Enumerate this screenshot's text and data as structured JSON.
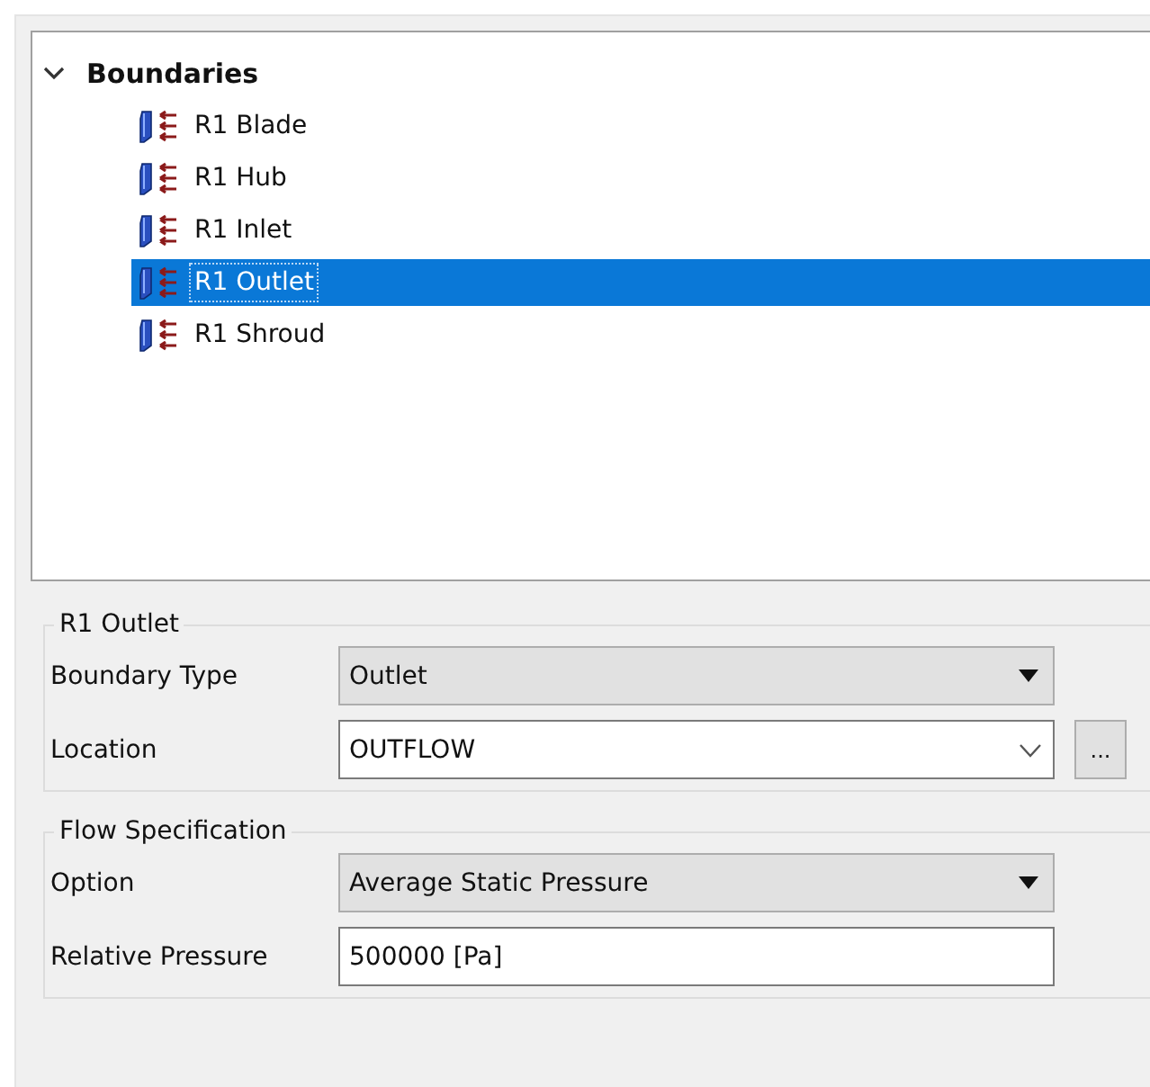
{
  "tree": {
    "root": {
      "label": "Boundaries",
      "expanded": true,
      "children": [
        {
          "label": "R1 Blade",
          "selected": false
        },
        {
          "label": "R1 Hub",
          "selected": false
        },
        {
          "label": "R1 Inlet",
          "selected": false
        },
        {
          "label": "R1 Outlet",
          "selected": true
        },
        {
          "label": "R1 Shroud",
          "selected": false
        }
      ]
    }
  },
  "groups": [
    {
      "title": "R1 Outlet",
      "fields": [
        {
          "kind": "dropdown",
          "label": "Boundary Type",
          "value": "Outlet"
        },
        {
          "kind": "combo",
          "label": "Location",
          "value": "OUTFLOW",
          "button": "..."
        }
      ]
    },
    {
      "title": "Flow Specification",
      "fields": [
        {
          "kind": "dropdown",
          "label": "Option",
          "value": "Average Static Pressure"
        },
        {
          "kind": "text",
          "label": "Relative Pressure",
          "value": "500000 [Pa]"
        }
      ]
    }
  ]
}
